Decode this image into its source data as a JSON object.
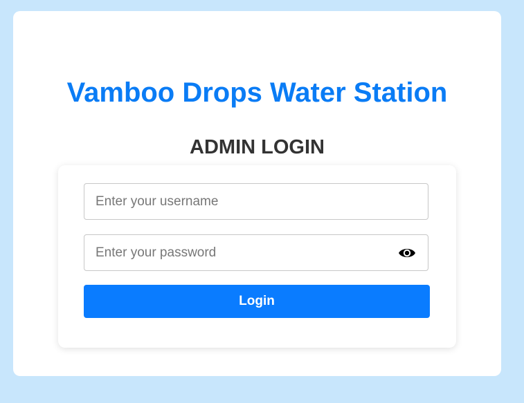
{
  "header": {
    "title": "Vamboo Drops Water Station",
    "subtitle": "ADMIN LOGIN"
  },
  "form": {
    "username": {
      "value": "",
      "placeholder": "Enter your username"
    },
    "password": {
      "value": "",
      "placeholder": "Enter your password",
      "toggle_icon": "eye-icon"
    },
    "login_label": "Login"
  },
  "colors": {
    "background": "#c8e6fc",
    "title": "#0a7cf5",
    "subtitle": "#333333",
    "button": "#0a7cff",
    "button_text": "#ffffff"
  }
}
